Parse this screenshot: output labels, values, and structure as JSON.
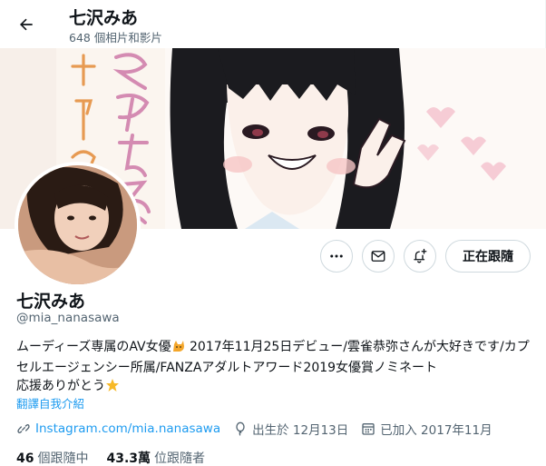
{
  "header": {
    "name": "七沢みあ",
    "media_count": "648 個相片和影片"
  },
  "banner": {
    "calligraphy_text": "みあちゃん\nかわいい",
    "description": "manga-style illustration of a girl making a peace sign"
  },
  "actions": {
    "more_icon": "more-horizontal-icon",
    "message_icon": "envelope-icon",
    "notify_icon": "bell-plus-icon",
    "follow_label": "正在跟隨"
  },
  "profile": {
    "name": "七沢みあ",
    "handle": "@mia_nanasawa",
    "bio_part1": "ムーディーズ専属のAV女優",
    "bio_part2": " 2017年11月25日デビュー/雲雀恭弥さんが大好きです/カプセルエージェンシー所属/FANZAアダルトアワード2019女優賞ノミネート",
    "bio_part3": "応援ありがとう",
    "translate_label": "翻譯自我介紹"
  },
  "meta": {
    "website": "Instagram.com/mia.nanasawa",
    "birthday": "出生於 12月13日",
    "joined": "已加入 2017年11月"
  },
  "stats": {
    "following_count": "46",
    "following_label": "個跟隨中",
    "followers_count": "43.3萬",
    "followers_label": "位跟隨者"
  },
  "colors": {
    "accent": "#1d9bf0",
    "text_primary": "#0f1419",
    "text_secondary": "#536471",
    "border": "#cfd9de"
  }
}
